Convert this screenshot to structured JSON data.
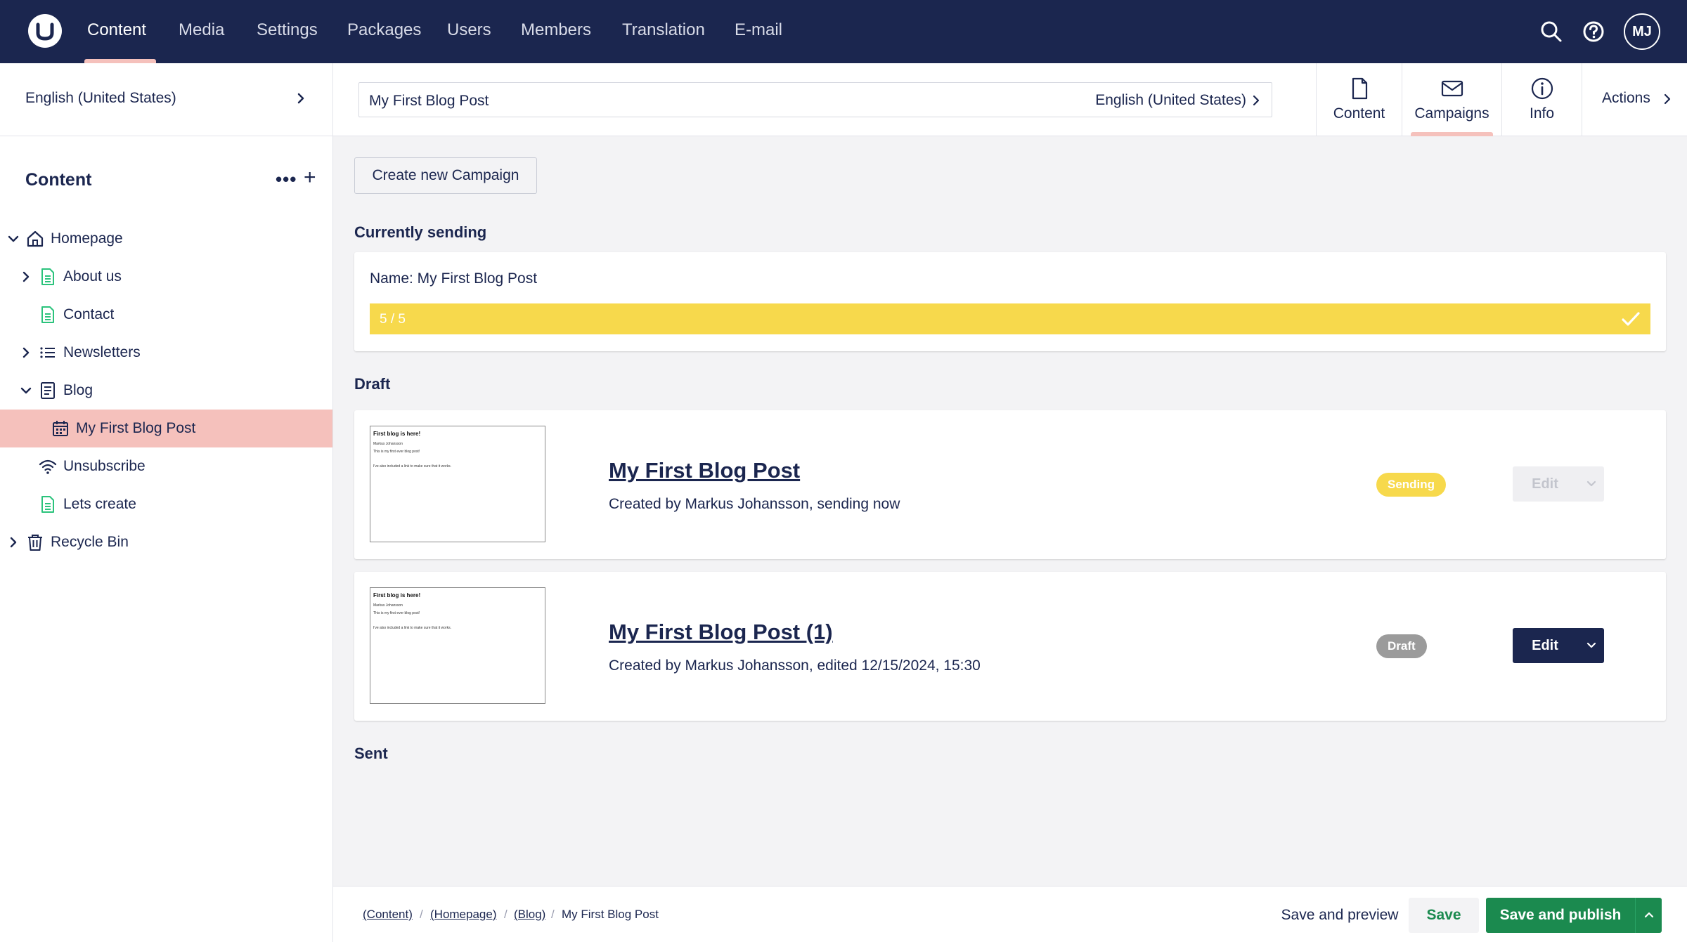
{
  "topnav": {
    "items": [
      "Content",
      "Media",
      "Settings",
      "Packages",
      "Users",
      "Members",
      "Translation",
      "E-mail"
    ],
    "active": "Content",
    "user_initials": "MJ"
  },
  "sidebar": {
    "language": "English (United States)",
    "title": "Content",
    "tree": [
      {
        "label": "Homepage",
        "icon": "home-icon",
        "expanded": true
      },
      {
        "label": "About us",
        "icon": "document-icon",
        "expanded": false
      },
      {
        "label": "Contact",
        "icon": "document-icon"
      },
      {
        "label": "Newsletters",
        "icon": "list-icon",
        "expanded": false
      },
      {
        "label": "Blog",
        "icon": "blog-icon",
        "expanded": true
      },
      {
        "label": "My First Blog Post",
        "icon": "calendar-icon",
        "selected": true
      },
      {
        "label": "Unsubscribe",
        "icon": "wifi-icon"
      },
      {
        "label": "Lets create",
        "icon": "document-icon"
      },
      {
        "label": "Recycle Bin",
        "icon": "trash-icon",
        "expanded": false
      }
    ]
  },
  "header": {
    "node_name": "My First Blog Post",
    "culture": "English (United States)",
    "tabs": [
      {
        "label": "Content",
        "icon": "document-icon"
      },
      {
        "label": "Campaigns",
        "icon": "envelope-icon",
        "active": true
      },
      {
        "label": "Info",
        "icon": "info-icon"
      }
    ],
    "actions_label": "Actions"
  },
  "main": {
    "create_button": "Create new Campaign",
    "currently_sending_title": "Currently sending",
    "sending": {
      "name": "Name: My First Blog Post",
      "progress_text": "5 / 5",
      "progress_fraction": 1.0
    },
    "draft_title": "Draft",
    "sent_title": "Sent",
    "campaigns": [
      {
        "title": "My First Blog Post",
        "subtitle": "Created by Markus Johansson, sending now",
        "status": "Sending",
        "edit_label": "Edit",
        "edit_enabled": false,
        "thumb_title": "First blog is here!",
        "thumb_lines": [
          "Markus Johansson",
          "This is my first ever blog post!",
          "I've also included a link to make sure that it works."
        ]
      },
      {
        "title": "My First Blog Post (1)",
        "subtitle": "Created by Markus Johansson, edited 12/15/2024, 15:30",
        "status": "Draft",
        "edit_label": "Edit",
        "edit_enabled": true,
        "thumb_title": "First blog is here!",
        "thumb_lines": [
          "Markus Johansson",
          "This is my first ever blog post!",
          "I've also included a link to make sure that it works."
        ]
      }
    ]
  },
  "footer": {
    "breadcrumbs": [
      "(Content)",
      "(Homepage)",
      "(Blog)",
      "My First Blog Post"
    ],
    "save_preview": "Save and preview",
    "save": "Save",
    "save_publish": "Save and publish"
  },
  "colors": {
    "nav_bg": "#1b264f",
    "accent_pink": "#f5c1bc",
    "sending_yellow": "#f7d94c",
    "draft_gray": "#9b9b9b",
    "publish_green": "#1b8a4f",
    "doc_icon_green": "#2bc37c"
  }
}
